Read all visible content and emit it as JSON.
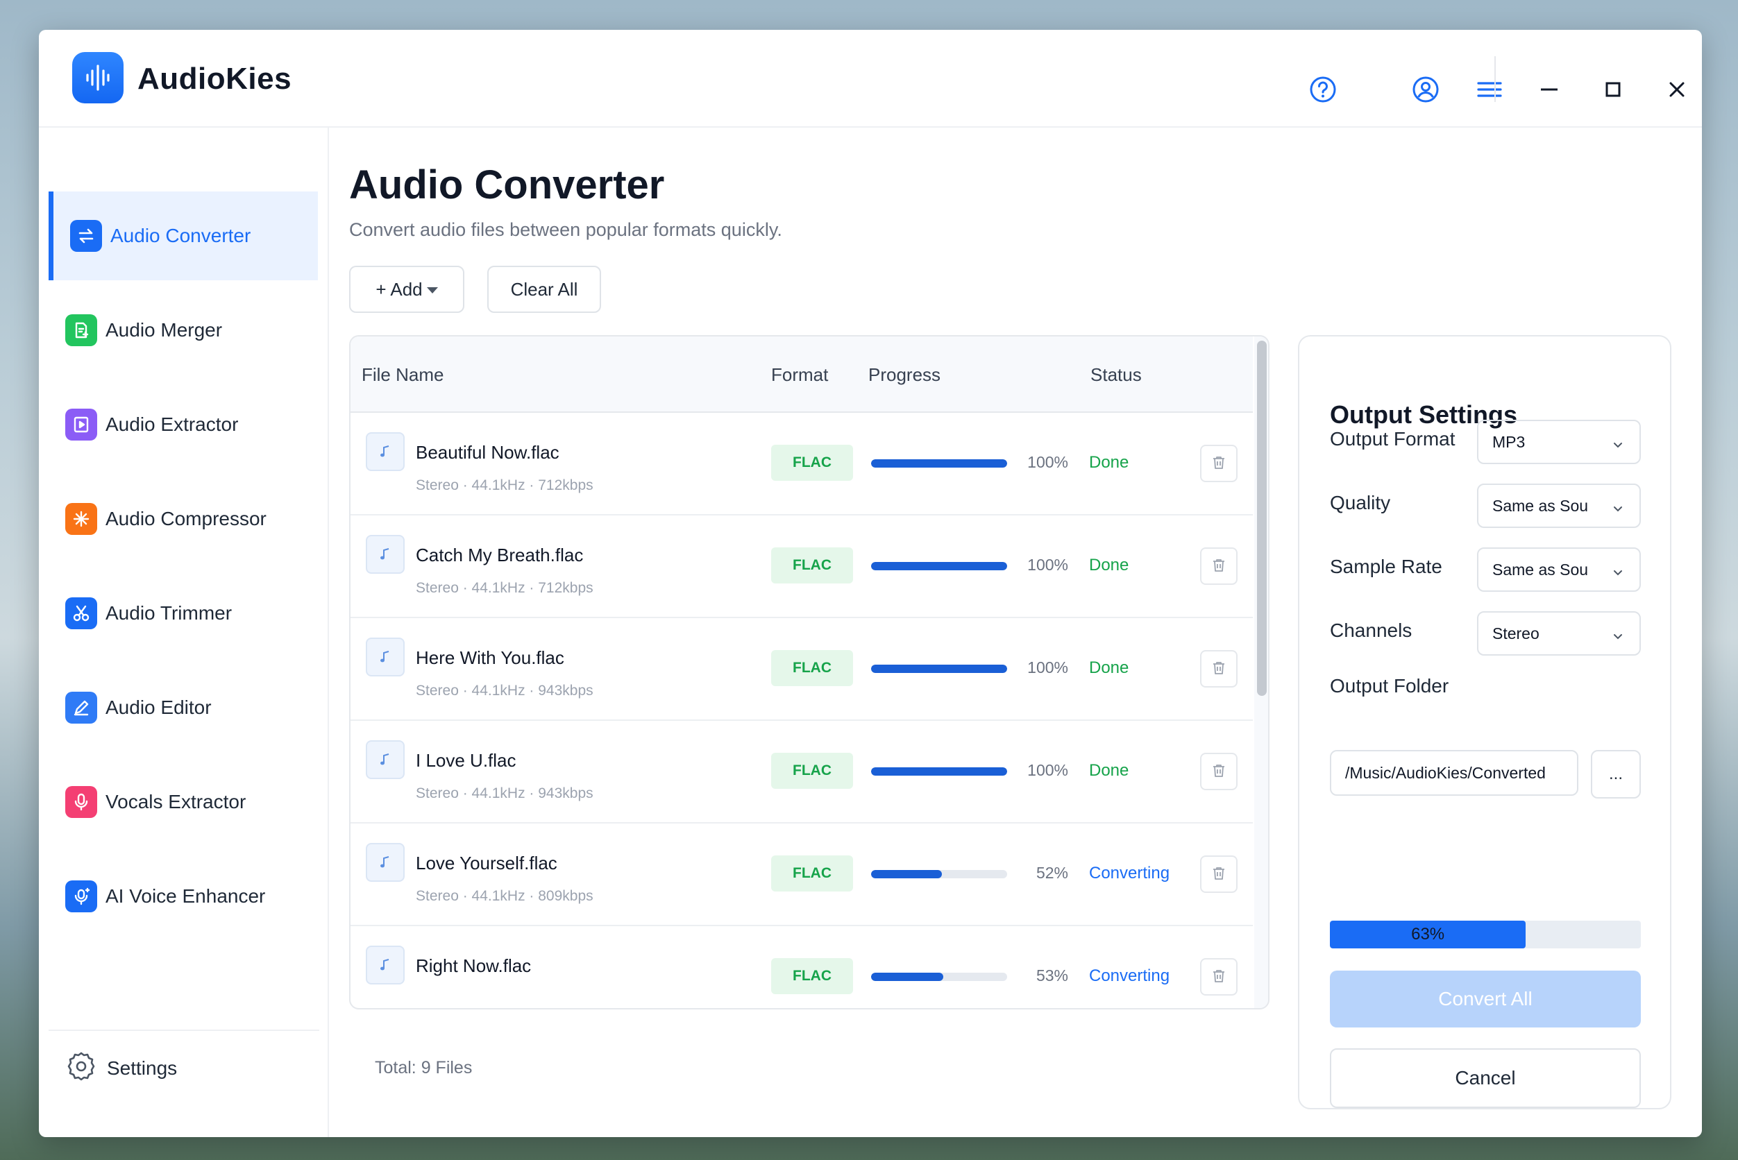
{
  "app": {
    "name": "AudioKies"
  },
  "sidebar": {
    "items": [
      {
        "label": "Audio Converter",
        "icon": "swap-arrows-icon",
        "color": "#1a6cf5",
        "active": true
      },
      {
        "label": "Audio Merger",
        "icon": "merge-document-icon",
        "color": "#22c55e",
        "active": false
      },
      {
        "label": "Audio Extractor",
        "icon": "film-icon",
        "color": "#8b5cf6",
        "active": false
      },
      {
        "label": "Audio Compressor",
        "icon": "compress-burst-icon",
        "color": "#f97316",
        "active": false
      },
      {
        "label": "Audio Trimmer",
        "icon": "scissors-icon",
        "color": "#1a6cf5",
        "active": false
      },
      {
        "label": "Audio Editor",
        "icon": "pencil-icon",
        "color": "#2f7bf6",
        "active": false
      },
      {
        "label": "Vocals Extractor",
        "icon": "microphone-icon",
        "color": "#f43f73",
        "active": false
      },
      {
        "label": "AI Voice Enhancer",
        "icon": "ai-microphone-icon",
        "color": "#1a6cf5",
        "active": false
      }
    ],
    "settings_label": "Settings"
  },
  "main": {
    "title": "Audio Converter",
    "subtitle": "Convert audio files between popular formats quickly.",
    "add_label": "+ Add",
    "clear_label": "Clear All",
    "columns": {
      "name": "File Name",
      "format": "Format",
      "progress": "Progress",
      "status": "Status"
    },
    "files": [
      {
        "name": "Beautiful Now.flac",
        "meta": "Stereo · 44.1kHz · 712kbps",
        "format": "FLAC",
        "progress": 100,
        "progress_label": "100%",
        "status": "Done"
      },
      {
        "name": "Catch My Breath.flac",
        "meta": "Stereo · 44.1kHz · 712kbps",
        "format": "FLAC",
        "progress": 100,
        "progress_label": "100%",
        "status": "Done"
      },
      {
        "name": "Here With You.flac",
        "meta": "Stereo · 44.1kHz · 943kbps",
        "format": "FLAC",
        "progress": 100,
        "progress_label": "100%",
        "status": "Done"
      },
      {
        "name": "I Love U.flac",
        "meta": "Stereo · 44.1kHz · 943kbps",
        "format": "FLAC",
        "progress": 100,
        "progress_label": "100%",
        "status": "Done"
      },
      {
        "name": "Love Yourself.flac",
        "meta": "Stereo · 44.1kHz · 809kbps",
        "format": "FLAC",
        "progress": 52,
        "progress_label": "52%",
        "status": "Converting"
      },
      {
        "name": "Right Now.flac",
        "meta": "",
        "format": "FLAC",
        "progress": 53,
        "progress_label": "53%",
        "status": "Converting"
      }
    ],
    "total_label": "Total: 9 Files"
  },
  "output": {
    "title": "Output Settings",
    "format_label": "Output Format",
    "format_value": "MP3",
    "quality_label": "Quality",
    "quality_value": "Same as Sou",
    "sample_rate_label": "Sample Rate",
    "sample_rate_value": "Same as Sou",
    "channels_label": "Channels",
    "channels_value": "Stereo",
    "folder_label": "Output Folder",
    "folder_value": "/Music/AudioKies/Converted",
    "browse_label": "...",
    "overall_progress": 63,
    "overall_progress_label": "63%",
    "convert_label": "Convert All",
    "cancel_label": "Cancel"
  },
  "colors": {
    "accent": "#1a6cf5",
    "done": "#16a34a",
    "converting": "#1a6cf5",
    "badge_bg": "#e5f7ea"
  }
}
